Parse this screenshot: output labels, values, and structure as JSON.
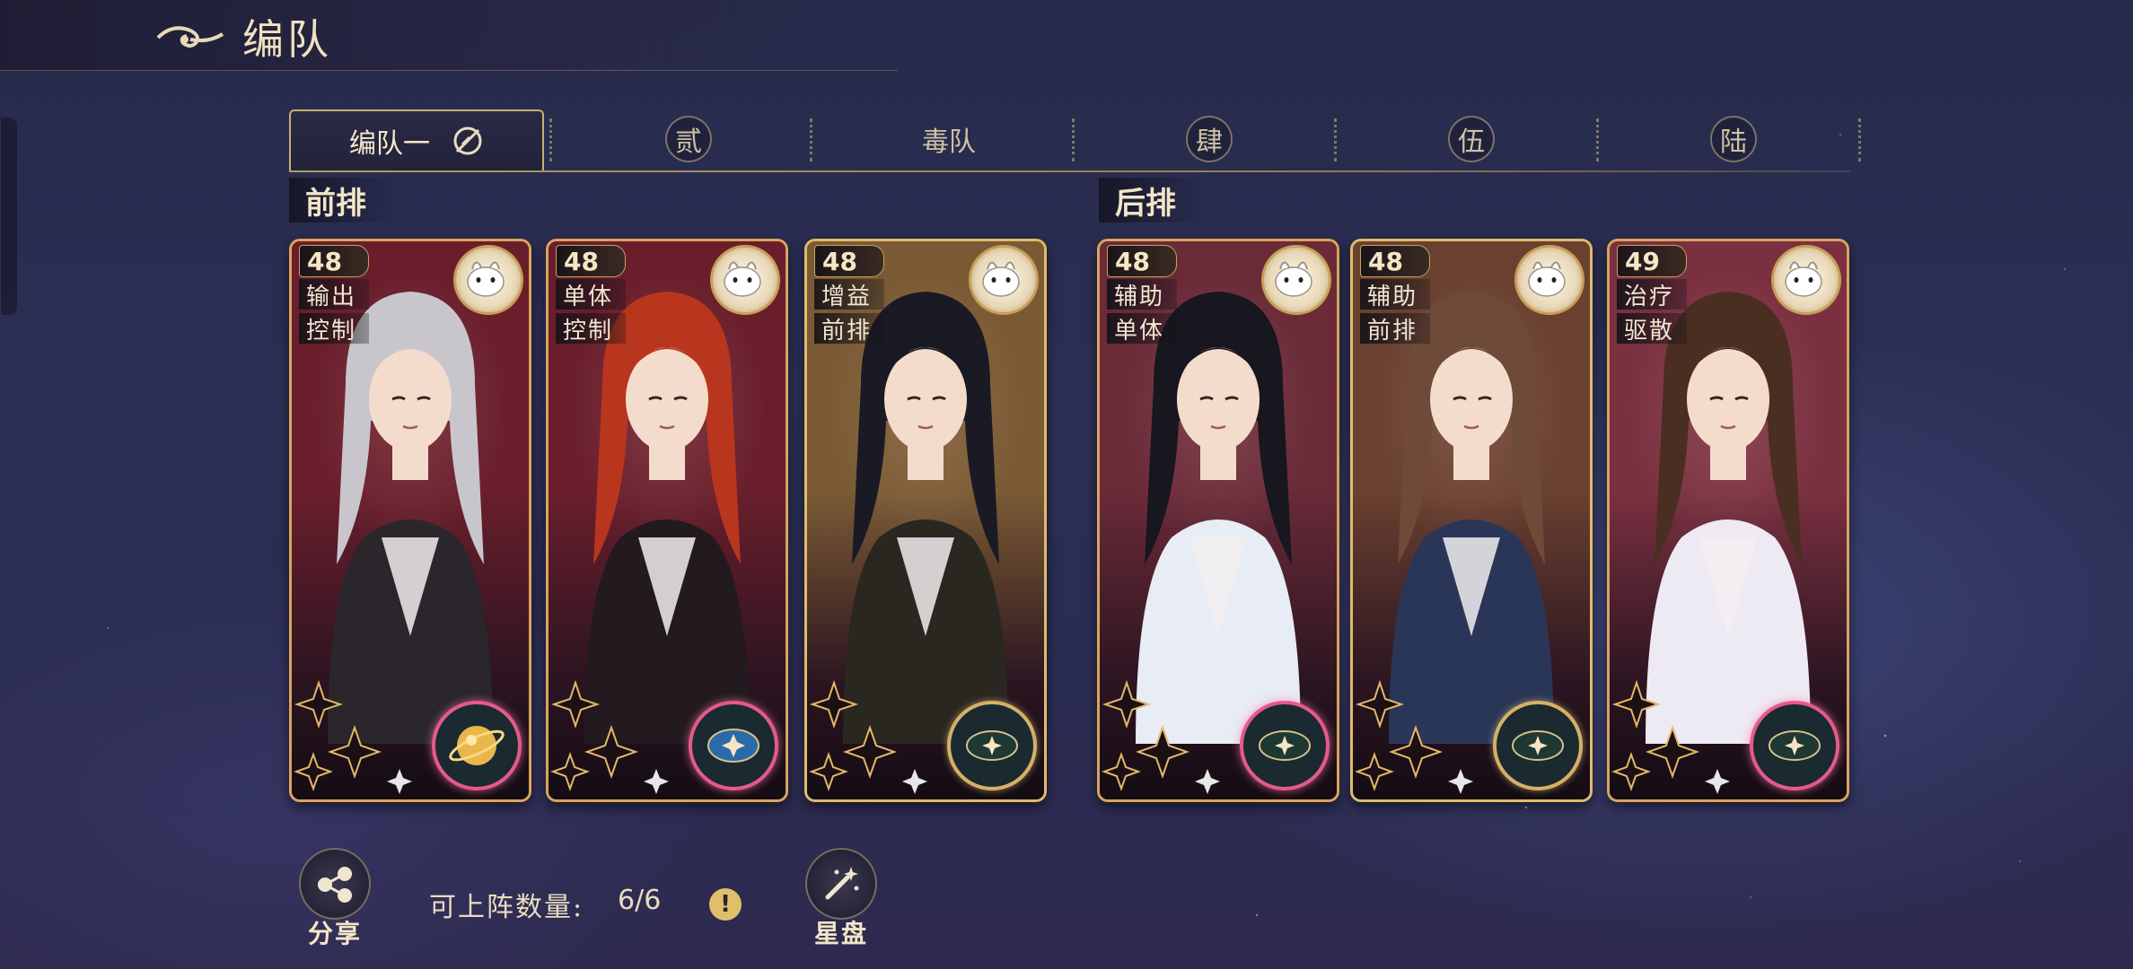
{
  "header": {
    "title": "编队",
    "icon": "cloud-swirl-icon"
  },
  "tabs": [
    {
      "label": "编队一",
      "active": true
    },
    {
      "label": "贰",
      "active": false
    },
    {
      "label": "毒队",
      "active": false
    },
    {
      "label": "肆",
      "active": false
    },
    {
      "label": "伍",
      "active": false
    },
    {
      "label": "陆",
      "active": false
    }
  ],
  "sections": {
    "front": "前排",
    "back": "后排"
  },
  "cards": [
    {
      "level": "48",
      "roles": [
        "输出",
        "控制"
      ],
      "spirit": "white-horse-icon",
      "badge": "golden-orb-icon",
      "frame": "#d9a45e",
      "hair": "#c8c6cc",
      "outfit": "#2a262c",
      "bg": "#6a1e2c"
    },
    {
      "level": "48",
      "roles": [
        "单体",
        "控制"
      ],
      "spirit": "white-rabbit-icon",
      "badge": "blue-star-compass-icon",
      "frame": "#d9a45e",
      "hair": "#b8361e",
      "outfit": "#221a1e",
      "bg": "#6a1e2c"
    },
    {
      "level": "48",
      "roles": [
        "增益",
        "前排"
      ],
      "spirit": "white-sheep-icon",
      "badge": "star-compass-icon",
      "frame": "#e0bb6a",
      "hair": "#1a1a24",
      "outfit": "#2a2620",
      "bg": "#7a5a34"
    },
    {
      "level": "48",
      "roles": [
        "辅助",
        "单体"
      ],
      "spirit": "monkey-icon",
      "badge": "star-compass-icon",
      "frame": "#d9a45e",
      "hair": "#18161e",
      "outfit": "#e8ecf4",
      "bg": "#6a2a38"
    },
    {
      "level": "48",
      "roles": [
        "辅助",
        "前排"
      ],
      "spirit": "white-sheep-icon",
      "badge": "star-compass-icon",
      "frame": "#e0bb6a",
      "hair": "#6e4a38",
      "outfit": "#2a3658",
      "bg": "#6a4030"
    },
    {
      "level": "49",
      "roles": [
        "治疗",
        "驱散"
      ],
      "spirit": "white-sheep-icon",
      "badge": "star-compass-icon",
      "frame": "#d9a45e",
      "hair": "#4a2e22",
      "outfit": "#eeeaf4",
      "bg": "#7a3040"
    }
  ],
  "footer": {
    "share_label": "分享",
    "count_label": "可上阵数量:",
    "count_value": "6/6",
    "starchart_label": "星盘"
  }
}
